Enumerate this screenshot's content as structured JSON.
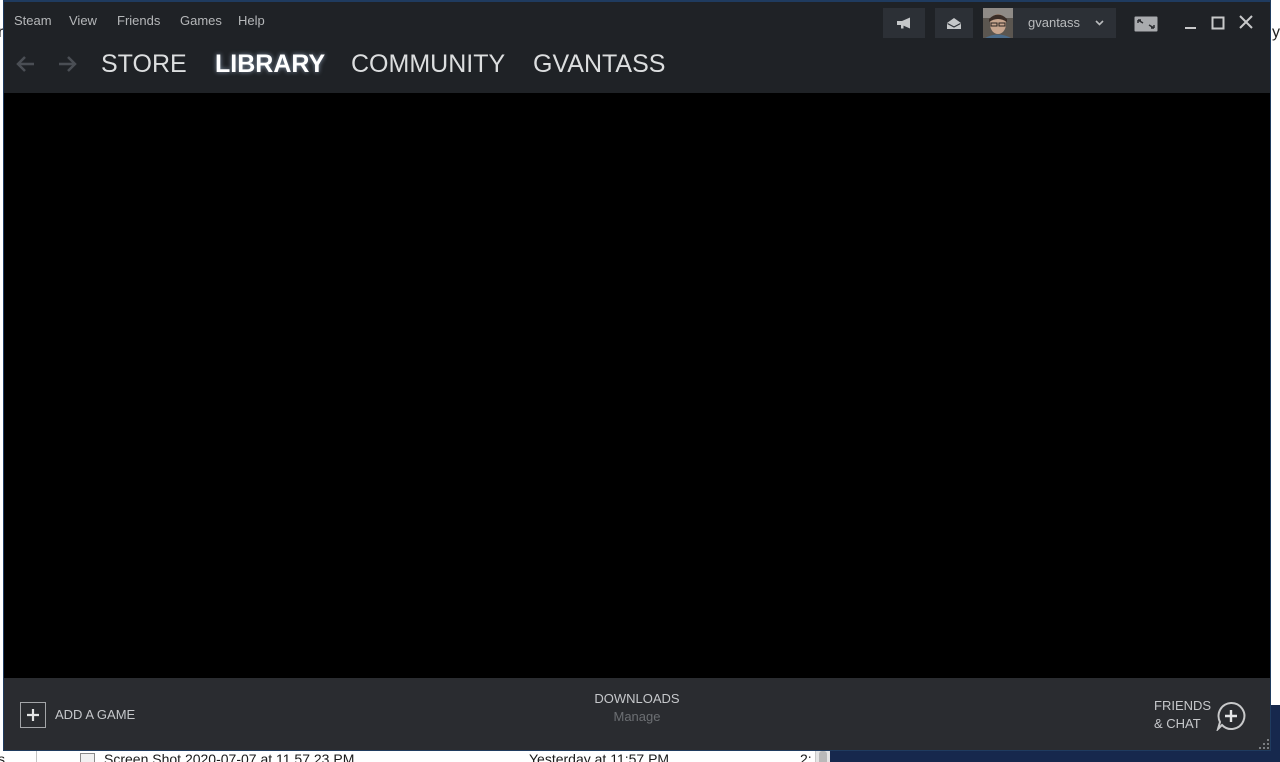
{
  "app": {
    "menu": [
      "Steam",
      "View",
      "Friends",
      "Games",
      "Help"
    ],
    "account": {
      "username": "gvantass"
    },
    "nav": {
      "tabs": [
        {
          "label": "STORE",
          "active": false
        },
        {
          "label": "LIBRARY",
          "active": true
        },
        {
          "label": "COMMUNITY",
          "active": false
        },
        {
          "label": "GVANTASS",
          "active": false
        }
      ]
    },
    "footer": {
      "add_game": "ADD A GAME",
      "downloads_title": "DOWNLOADS",
      "downloads_action": "Manage",
      "friends_line1": "FRIENDS",
      "friends_line2": "& CHAT"
    }
  },
  "background": {
    "left_edge_text": "r",
    "right_edge_text": "yr",
    "left_edge_bottom_text": "s",
    "file_row": {
      "name": "Screen Shot 2020-07-07 at 11.57.23 PM",
      "date": "Yesterday at 11:57 PM",
      "size": "2:"
    }
  },
  "icons": {
    "announcements": "megaphone-icon",
    "notifications": "envelope-icon",
    "account_menu": "chevron-down-icon",
    "big_picture": "big-picture-icon",
    "add_game": "plus-icon",
    "friends": "add-friend-chat-icon"
  },
  "colors": {
    "header_bg": "#1f2226",
    "button_bg": "#2c3036",
    "content_bg": "#000000",
    "footer_bg": "#2a2c30",
    "nav_text": "#dcdedf",
    "nav_active": "#ffffff",
    "menu_text": "#b5b7b9",
    "window_border": "#1f3b5f",
    "desktop": "#16284d"
  }
}
